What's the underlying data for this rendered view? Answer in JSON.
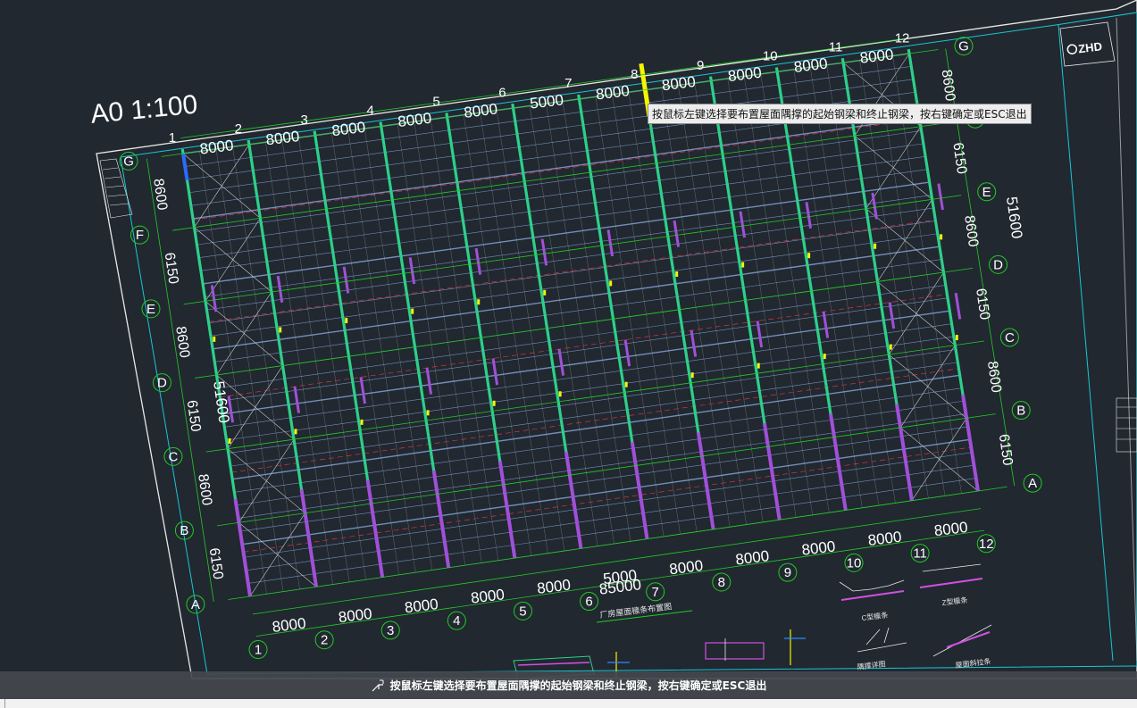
{
  "drawing": {
    "scale_label": "A0 1:100",
    "column_labels": [
      "1",
      "2",
      "3",
      "4",
      "5",
      "6",
      "7",
      "8",
      "9",
      "10",
      "11",
      "12"
    ],
    "row_labels": [
      "A",
      "B",
      "C",
      "D",
      "E",
      "F",
      "G"
    ],
    "bay_dimension": "8000",
    "special_bay_dimension": "5000",
    "total_length": "85000",
    "left_dimensions": [
      "8600",
      "6150",
      "8600",
      "6150",
      "8600",
      "6150",
      "8600"
    ],
    "total_width": "51600",
    "logo_text": "ZHD",
    "drawing_title": "厂房屋面檩条布置图",
    "detail_labels": [
      "C型檩条",
      "Z型檩条",
      "屋面斜拉条",
      "隅撑详图"
    ]
  },
  "tooltip": {
    "text": "按鼠标左键选择要布置屋面隅撑的起始钢梁和终止钢梁，按右键确定或ESC退出"
  },
  "command_bar": {
    "icon": "cursor-select-icon",
    "prompt": "按鼠标左键选择要布置屋面隅撑的起始钢梁和终止钢梁，按右键确定或ESC退出"
  },
  "colors": {
    "background": "#212830",
    "grid_axis": "#22cc22",
    "steel_beam": "#2ecf8a",
    "purlin": "#8fb0e8",
    "column": "#a050d8",
    "frame": "#19c7d4",
    "highlight": "#f5f500"
  }
}
